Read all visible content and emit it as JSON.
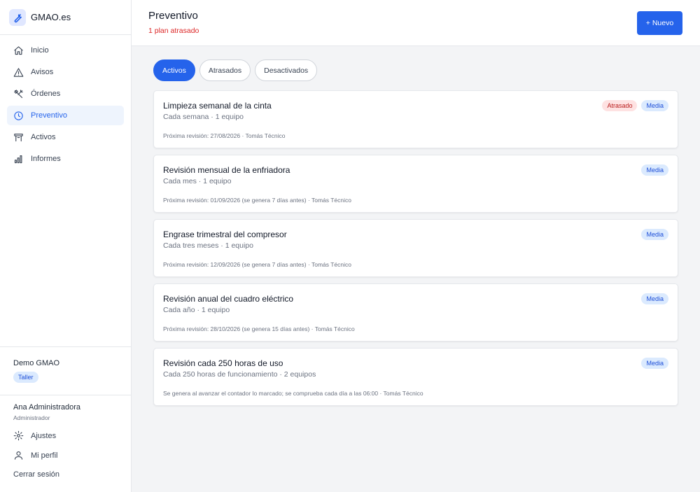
{
  "brand": {
    "name": "GMAO.es",
    "icon": "wrench-icon",
    "accent": "#2563eb"
  },
  "nav": {
    "items": [
      {
        "label": "Inicio",
        "icon": "home-icon"
      },
      {
        "label": "Avisos",
        "icon": "warning-icon"
      },
      {
        "label": "Órdenes",
        "icon": "tools-icon"
      },
      {
        "label": "Preventivo",
        "icon": "clock-icon",
        "active": true
      },
      {
        "label": "Activos",
        "icon": "asset-icon"
      },
      {
        "label": "Informes",
        "icon": "bar-chart-icon"
      }
    ]
  },
  "org": {
    "name": "Demo GMAO",
    "badge": "Taller"
  },
  "user": {
    "name": "Ana Administradora",
    "role": "Administrador",
    "settings_label": "Ajustes",
    "profile_label": "Mi perfil",
    "logout_label": "Cerrar sesión"
  },
  "header": {
    "title": "Preventivo",
    "subtitle": "1 plan atrasado",
    "new_button": "+ Nuevo"
  },
  "tabs": [
    {
      "label": "Activos",
      "active": true
    },
    {
      "label": "Atrasados",
      "active": false
    },
    {
      "label": "Desactivados",
      "active": false
    }
  ],
  "plans": [
    {
      "title": "Limpieza semanal de la cinta",
      "frequency": "Cada semana · 1 equipo",
      "next": "Próxima revisión: 27/08/2026 · Tomás Técnico",
      "overdue": "Atrasado",
      "priority": "Media"
    },
    {
      "title": "Revisión mensual de la enfriadora",
      "frequency": "Cada mes · 1 equipo",
      "next": "Próxima revisión: 01/09/2026 (se genera 7 días antes) · Tomás Técnico",
      "priority": "Media"
    },
    {
      "title": "Engrase trimestral del compresor",
      "frequency": "Cada tres meses · 1 equipo",
      "next": "Próxima revisión: 12/09/2026 (se genera 7 días antes) · Tomás Técnico",
      "priority": "Media"
    },
    {
      "title": "Revisión anual del cuadro eléctrico",
      "frequency": "Cada año · 1 equipo",
      "next": "Próxima revisión: 28/10/2026 (se genera 15 días antes) · Tomás Técnico",
      "priority": "Media"
    },
    {
      "title": "Revisión cada 250 horas de uso",
      "frequency": "Cada 250 horas de funcionamiento · 2 equipos",
      "next": "Se genera al avanzar el contador lo marcado; se comprueba cada día a las 06:00 · Tomás Técnico",
      "priority": "Media"
    }
  ]
}
